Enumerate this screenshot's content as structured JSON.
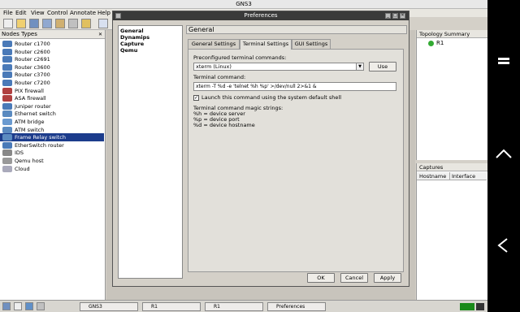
{
  "window": {
    "title": "GNS3"
  },
  "menu": [
    "File",
    "Edit",
    "View",
    "Control",
    "Annotate",
    "Help"
  ],
  "nodes_panel": {
    "title": "Nodes Types",
    "items": [
      {
        "label": "Router c1700",
        "icon": "router-icon"
      },
      {
        "label": "Router c2600",
        "icon": "router-icon"
      },
      {
        "label": "Router c2691",
        "icon": "router-icon"
      },
      {
        "label": "Router c3600",
        "icon": "router-icon"
      },
      {
        "label": "Router c3700",
        "icon": "router-icon"
      },
      {
        "label": "Router c7200",
        "icon": "router-icon"
      },
      {
        "label": "PIX firewall",
        "icon": "firewall-icon"
      },
      {
        "label": "ASA firewall",
        "icon": "firewall-icon"
      },
      {
        "label": "Juniper router",
        "icon": "router-icon"
      },
      {
        "label": "Ethernet switch",
        "icon": "switch-icon"
      },
      {
        "label": "ATM bridge",
        "icon": "bridge-icon"
      },
      {
        "label": "ATM switch",
        "icon": "switch-icon"
      },
      {
        "label": "Frame Relay switch",
        "icon": "switch-icon",
        "selected": true
      },
      {
        "label": "EtherSwitch router",
        "icon": "router-icon"
      },
      {
        "label": "IDS",
        "icon": "ids-icon"
      },
      {
        "label": "Qemu host",
        "icon": "host-icon"
      },
      {
        "label": "Cloud",
        "icon": "cloud-icon"
      }
    ]
  },
  "topology": {
    "title": "Topology Summary",
    "items": [
      "R1"
    ]
  },
  "captures": {
    "title": "Captures",
    "columns": [
      "Hostname",
      "Interface"
    ]
  },
  "dialog": {
    "title": "Preferences",
    "categories": [
      "General",
      "Dynamips",
      "Capture",
      "Qemu"
    ],
    "section_title": "General",
    "tabs": [
      "General Settings",
      "Terminal Settings",
      "GUI Settings"
    ],
    "active_tab": "Terminal Settings",
    "preconfigured_label": "Preconfigured terminal commands:",
    "preconfigured_value": "xterm (Linux)",
    "use_label": "Use",
    "terminal_label": "Terminal command:",
    "terminal_value": "xterm -T %d -e 'telnet %h %p' >/dev/null 2>&1 &",
    "checkbox_label": "Launch this command using the system default shell",
    "checkbox_checked": true,
    "magic_title": "Terminal command magic strings:",
    "magic_lines": [
      "%h = device server",
      "%p = device port",
      "%d = device hostname"
    ],
    "ok_label": "OK",
    "cancel_label": "Cancel",
    "apply_label": "Apply"
  },
  "taskbar": {
    "tasks": [
      "GNS3",
      "R1",
      "R1",
      "Preferences"
    ]
  },
  "colors": {
    "selection": "#1c3c8c",
    "dialog_title": "#3a3a3a",
    "topology_node": "#33aa33"
  }
}
